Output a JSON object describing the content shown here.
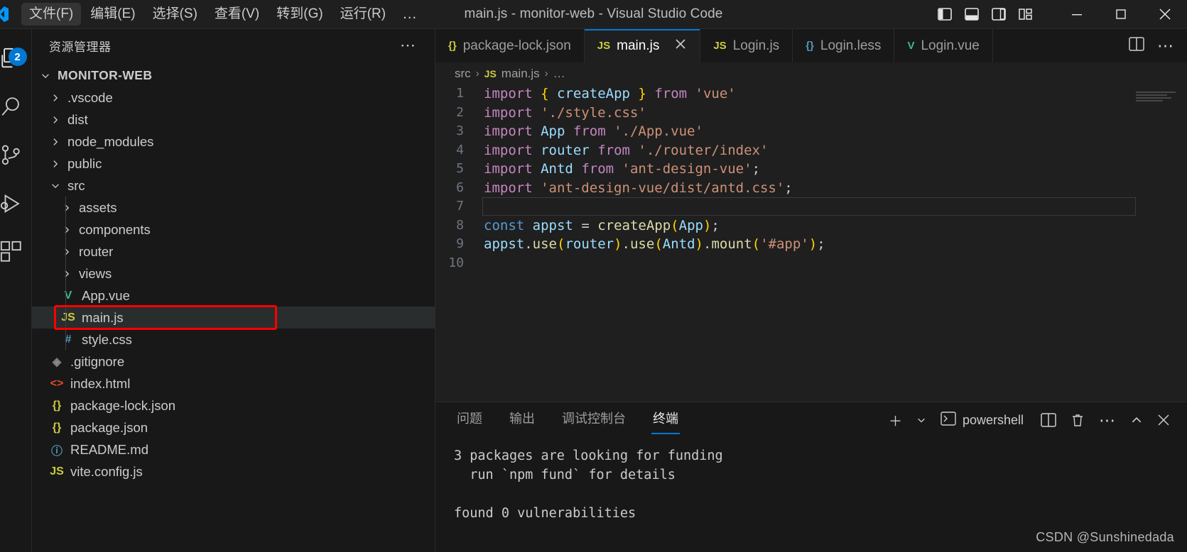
{
  "titlebar": {
    "logo_icon": "vscode-logo-icon",
    "menus": [
      {
        "label": "文件(F)",
        "active": true
      },
      {
        "label": "编辑(E)",
        "active": false
      },
      {
        "label": "选择(S)",
        "active": false
      },
      {
        "label": "查看(V)",
        "active": false
      },
      {
        "label": "转到(G)",
        "active": false
      },
      {
        "label": "运行(R)",
        "active": false
      }
    ],
    "overflow_label": "…",
    "window_title": "main.js - monitor-web - Visual Studio Code",
    "layout_buttons": [
      {
        "name": "toggle-primary-sidebar-icon"
      },
      {
        "name": "toggle-panel-icon"
      },
      {
        "name": "toggle-secondary-sidebar-icon"
      },
      {
        "name": "customize-layout-icon"
      }
    ],
    "window_controls": [
      {
        "name": "minimize-button",
        "glyph": "minimize-icon"
      },
      {
        "name": "maximize-button",
        "glyph": "maximize-icon"
      },
      {
        "name": "close-button",
        "glyph": "close-icon"
      }
    ]
  },
  "activitybar": {
    "items": [
      {
        "name": "explorer",
        "icon": "files-icon",
        "badge": "2",
        "active": true
      },
      {
        "name": "search",
        "icon": "search-icon",
        "badge": "",
        "active": false
      },
      {
        "name": "source-control",
        "icon": "source-control-icon",
        "badge": "",
        "active": false
      },
      {
        "name": "run-and-debug",
        "icon": "run-debug-icon",
        "badge": "",
        "active": false
      },
      {
        "name": "extensions",
        "icon": "extensions-icon",
        "badge": "",
        "active": false
      }
    ]
  },
  "sidebar": {
    "title": "资源管理器",
    "more_actions": "⋯",
    "root": {
      "label": "MONITOR-WEB",
      "expanded": true,
      "twisty": "chevron-down-icon"
    },
    "tree": [
      {
        "label": ".vscode",
        "indent": 1,
        "type": "folder",
        "expanded": false,
        "icon": "chevron-right-icon",
        "icon_color": "#cccccc",
        "selected": false
      },
      {
        "label": "dist",
        "indent": 1,
        "type": "folder",
        "expanded": false,
        "icon": "chevron-right-icon",
        "icon_color": "#cccccc",
        "selected": false
      },
      {
        "label": "node_modules",
        "indent": 1,
        "type": "folder",
        "expanded": false,
        "icon": "chevron-right-icon",
        "icon_color": "#cccccc",
        "selected": false
      },
      {
        "label": "public",
        "indent": 1,
        "type": "folder",
        "expanded": false,
        "icon": "chevron-right-icon",
        "icon_color": "#cccccc",
        "selected": false
      },
      {
        "label": "src",
        "indent": 1,
        "type": "folder",
        "expanded": true,
        "icon": "chevron-down-icon",
        "icon_color": "#cccccc",
        "selected": false
      },
      {
        "label": "assets",
        "indent": 2,
        "type": "folder",
        "expanded": false,
        "icon": "chevron-right-icon",
        "icon_color": "#cccccc",
        "selected": false
      },
      {
        "label": "components",
        "indent": 2,
        "type": "folder",
        "expanded": false,
        "icon": "chevron-right-icon",
        "icon_color": "#cccccc",
        "selected": false
      },
      {
        "label": "router",
        "indent": 2,
        "type": "folder",
        "expanded": false,
        "icon": "chevron-right-icon",
        "icon_color": "#cccccc",
        "selected": false
      },
      {
        "label": "views",
        "indent": 2,
        "type": "folder",
        "expanded": false,
        "icon": "chevron-right-icon",
        "icon_color": "#cccccc",
        "selected": false
      },
      {
        "label": "App.vue",
        "indent": 2,
        "type": "file",
        "glyph": "V",
        "icon": "vue-file-icon",
        "icon_color": "#41b883",
        "selected": false
      },
      {
        "label": "main.js",
        "indent": 2,
        "type": "file",
        "glyph": "JS",
        "icon": "js-file-icon",
        "icon_color": "#cbcb41",
        "selected": true
      },
      {
        "label": "style.css",
        "indent": 2,
        "type": "file",
        "glyph": "#",
        "icon": "css-file-icon",
        "icon_color": "#519aba",
        "selected": false
      },
      {
        "label": ".gitignore",
        "indent": 1,
        "type": "file",
        "glyph": "◈",
        "icon": "git-file-icon",
        "icon_color": "#8a8a8a",
        "selected": false
      },
      {
        "label": "index.html",
        "indent": 1,
        "type": "file",
        "glyph": "<>",
        "icon": "html-file-icon",
        "icon_color": "#e44d26",
        "selected": false
      },
      {
        "label": "package-lock.json",
        "indent": 1,
        "type": "file",
        "glyph": "{}",
        "icon": "json-file-icon",
        "icon_color": "#cbcb41",
        "selected": false
      },
      {
        "label": "package.json",
        "indent": 1,
        "type": "file",
        "glyph": "{}",
        "icon": "json-file-icon",
        "icon_color": "#cbcb41",
        "selected": false
      },
      {
        "label": "README.md",
        "indent": 1,
        "type": "file",
        "glyph": "ⓘ",
        "icon": "markdown-file-icon",
        "icon_color": "#519aba",
        "selected": false
      },
      {
        "label": "vite.config.js",
        "indent": 1,
        "type": "file",
        "glyph": "JS",
        "icon": "js-file-icon",
        "icon_color": "#cbcb41",
        "selected": false
      }
    ],
    "highlight_color": "#ff0000"
  },
  "editor": {
    "tabs": [
      {
        "label": "package-lock.json",
        "glyph": "{}",
        "glyph_color": "#cbcb41",
        "active": false,
        "closable": false
      },
      {
        "label": "main.js",
        "glyph": "JS",
        "glyph_color": "#cbcb41",
        "active": true,
        "closable": true
      },
      {
        "label": "Login.js",
        "glyph": "JS",
        "glyph_color": "#cbcb41",
        "active": false,
        "closable": false
      },
      {
        "label": "Login.less",
        "glyph": "{}",
        "glyph_color": "#519aba",
        "active": false,
        "closable": false
      },
      {
        "label": "Login.vue",
        "glyph": "V",
        "glyph_color": "#41b883",
        "active": false,
        "closable": false
      }
    ],
    "tabbar_actions": [
      {
        "name": "split-editor-right-icon"
      },
      {
        "name": "more-editor-actions-icon",
        "label": "⋯"
      }
    ],
    "breadcrumb": {
      "folder": "src",
      "file": "main.js",
      "file_glyph": "JS",
      "tail": "…",
      "separator": "›"
    },
    "active_line": 7,
    "lines": [
      {
        "n": 1,
        "tokens": [
          {
            "t": "import",
            "c": "kw"
          },
          {
            "t": " ",
            "c": "pl"
          },
          {
            "t": "{",
            "c": "br"
          },
          {
            "t": " ",
            "c": "pl"
          },
          {
            "t": "createApp",
            "c": "id"
          },
          {
            "t": " ",
            "c": "pl"
          },
          {
            "t": "}",
            "c": "br"
          },
          {
            "t": " ",
            "c": "pl"
          },
          {
            "t": "from",
            "c": "kw"
          },
          {
            "t": " ",
            "c": "pl"
          },
          {
            "t": "'vue'",
            "c": "str"
          }
        ]
      },
      {
        "n": 2,
        "tokens": [
          {
            "t": "import",
            "c": "kw"
          },
          {
            "t": " ",
            "c": "pl"
          },
          {
            "t": "'./style.css'",
            "c": "str"
          }
        ]
      },
      {
        "n": 3,
        "tokens": [
          {
            "t": "import",
            "c": "kw"
          },
          {
            "t": " ",
            "c": "pl"
          },
          {
            "t": "App",
            "c": "id"
          },
          {
            "t": " ",
            "c": "pl"
          },
          {
            "t": "from",
            "c": "kw"
          },
          {
            "t": " ",
            "c": "pl"
          },
          {
            "t": "'./App.vue'",
            "c": "str"
          }
        ]
      },
      {
        "n": 4,
        "tokens": [
          {
            "t": "import",
            "c": "kw"
          },
          {
            "t": " ",
            "c": "pl"
          },
          {
            "t": "router",
            "c": "id"
          },
          {
            "t": " ",
            "c": "pl"
          },
          {
            "t": "from",
            "c": "kw"
          },
          {
            "t": " ",
            "c": "pl"
          },
          {
            "t": "'./router/index'",
            "c": "str"
          }
        ]
      },
      {
        "n": 5,
        "tokens": [
          {
            "t": "import",
            "c": "kw"
          },
          {
            "t": " ",
            "c": "pl"
          },
          {
            "t": "Antd",
            "c": "id"
          },
          {
            "t": " ",
            "c": "pl"
          },
          {
            "t": "from",
            "c": "kw"
          },
          {
            "t": " ",
            "c": "pl"
          },
          {
            "t": "'ant-design-vue'",
            "c": "str"
          },
          {
            "t": ";",
            "c": "pl"
          }
        ]
      },
      {
        "n": 6,
        "tokens": [
          {
            "t": "import",
            "c": "kw"
          },
          {
            "t": " ",
            "c": "pl"
          },
          {
            "t": "'ant-design-vue/dist/antd.css'",
            "c": "str"
          },
          {
            "t": ";",
            "c": "pl"
          }
        ]
      },
      {
        "n": 7,
        "tokens": []
      },
      {
        "n": 8,
        "tokens": [
          {
            "t": "const",
            "c": "const"
          },
          {
            "t": " ",
            "c": "pl"
          },
          {
            "t": "appst",
            "c": "id"
          },
          {
            "t": " ",
            "c": "pl"
          },
          {
            "t": "=",
            "c": "pl"
          },
          {
            "t": " ",
            "c": "pl"
          },
          {
            "t": "createApp",
            "c": "fn"
          },
          {
            "t": "(",
            "c": "br"
          },
          {
            "t": "App",
            "c": "id"
          },
          {
            "t": ")",
            "c": "br"
          },
          {
            "t": ";",
            "c": "pl"
          }
        ]
      },
      {
        "n": 9,
        "tokens": [
          {
            "t": "appst",
            "c": "id"
          },
          {
            "t": ".",
            "c": "pl"
          },
          {
            "t": "use",
            "c": "fn"
          },
          {
            "t": "(",
            "c": "br"
          },
          {
            "t": "router",
            "c": "id"
          },
          {
            "t": ")",
            "c": "br"
          },
          {
            "t": ".",
            "c": "pl"
          },
          {
            "t": "use",
            "c": "fn"
          },
          {
            "t": "(",
            "c": "br"
          },
          {
            "t": "Antd",
            "c": "id"
          },
          {
            "t": ")",
            "c": "br"
          },
          {
            "t": ".",
            "c": "pl"
          },
          {
            "t": "mount",
            "c": "fn"
          },
          {
            "t": "(",
            "c": "br"
          },
          {
            "t": "'#app'",
            "c": "str"
          },
          {
            "t": ")",
            "c": "br"
          },
          {
            "t": ";",
            "c": "pl"
          }
        ]
      },
      {
        "n": 10,
        "tokens": []
      }
    ]
  },
  "panel": {
    "tabs": [
      {
        "label": "问题",
        "active": false
      },
      {
        "label": "输出",
        "active": false
      },
      {
        "label": "调试控制台",
        "active": false
      },
      {
        "label": "终端",
        "active": true
      }
    ],
    "actions": {
      "new_terminal": "＋",
      "new_terminal_dropdown": "chevron-down-icon",
      "shell_name": "powershell",
      "shell_icon": "terminal-icon",
      "split_icon": "split-terminal-icon",
      "kill_icon": "trash-icon",
      "more_icon": "⋯",
      "maximize_icon": "chevron-up-icon",
      "close_icon": "close-icon"
    },
    "terminal_lines": [
      "3 packages are looking for funding",
      "  run `npm fund` for details",
      "",
      "found 0 vulnerabilities"
    ]
  },
  "watermark": "CSDN @Sunshinedada"
}
